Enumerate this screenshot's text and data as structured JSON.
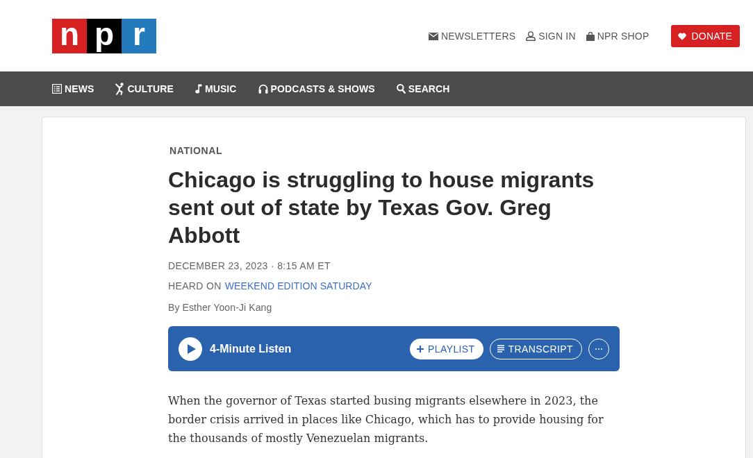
{
  "header": {
    "logo": [
      {
        "letter": "n",
        "color": "#d62021"
      },
      {
        "letter": "p",
        "color": "#000000"
      },
      {
        "letter": "r",
        "color": "#237bbd"
      }
    ],
    "utility_links": [
      {
        "kind": "newsletters",
        "label": "NEWSLETTERS"
      },
      {
        "kind": "sign_in",
        "label": "SIGN IN"
      },
      {
        "kind": "shop",
        "label": "NPR SHOP"
      }
    ],
    "donate_button": "DONATE"
  },
  "nav": [
    {
      "kind": "news",
      "label": "NEWS"
    },
    {
      "kind": "culture",
      "label": "CULTURE"
    },
    {
      "kind": "music",
      "label": "MUSIC"
    },
    {
      "kind": "podcasts",
      "label": "PODCASTS & SHOWS"
    },
    {
      "kind": "search",
      "label": "SEARCH"
    }
  ],
  "article": {
    "section": "NATIONAL",
    "headline": "Chicago is struggling to house migrants sent out of state by Texas Gov. Greg Abbott",
    "dateline": "DECEMBER 23, 2023 · 8:15 AM ET",
    "heard_on": {
      "prefix": "HEARD ON",
      "program": "WEEKEND EDITION SATURDAY"
    },
    "byline": "By Esther Yoon-Ji Kang",
    "audio_player": {
      "title": "4-Minute Listen",
      "buttons": [
        {
          "kind": "playlist",
          "label": "PLAYLIST"
        },
        {
          "kind": "transcript",
          "label": "TRANSCRIPT"
        },
        {
          "kind": "more"
        }
      ]
    },
    "body": [
      "When the governor of Texas started busing migrants elsewhere in 2023, the border crisis arrived in places like Chicago, which has to provide housing for the thousands of mostly Venezuelan migrants."
    ]
  }
}
